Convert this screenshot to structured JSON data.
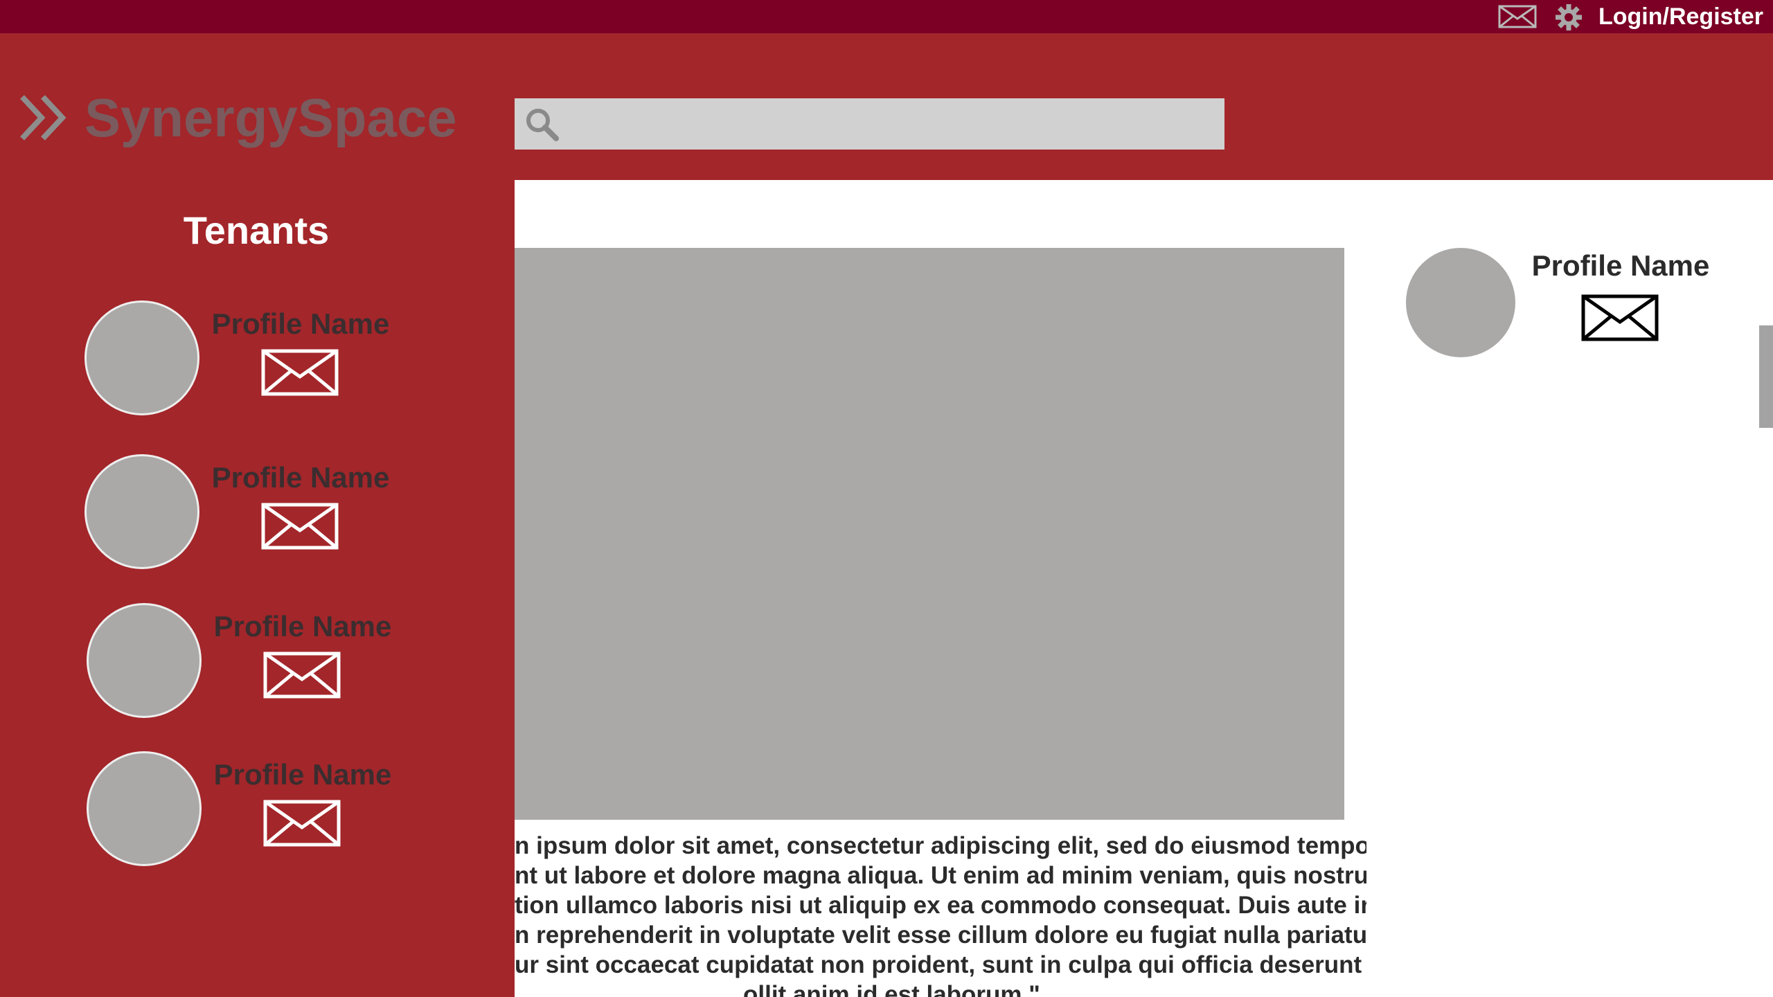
{
  "topbar": {
    "login_label": "Login/Register",
    "icons": [
      "mail-icon",
      "gear-icon"
    ]
  },
  "brand": {
    "name": "SynergySpace",
    "icon": "chevrons-icon"
  },
  "search": {
    "placeholder": "",
    "value": "",
    "icon": "search-icon"
  },
  "sidebar": {
    "title": "Tenants",
    "tenants": [
      {
        "name": "Profile Name"
      },
      {
        "name": "Profile Name"
      },
      {
        "name": "Profile Name"
      },
      {
        "name": "Profile Name"
      }
    ]
  },
  "main": {
    "body_lines": [
      "n ipsum dolor sit amet, consectetur adipiscing elit, sed do eiusmod tempor",
      "nt ut labore et dolore magna aliqua. Ut enim ad minim veniam, quis nostrud",
      "tion ullamco laboris nisi ut aliquip ex ea commodo consequat. Duis aute irure",
      "n reprehenderit in voluptate velit esse cillum dolore eu fugiat nulla pariatur.",
      "ur sint occaecat cupidatat non proident, sunt in culpa qui officia deserunt m",
      "ollit anim id est laborum.\""
    ],
    "side_profile": {
      "name": "Profile Name"
    }
  },
  "colors": {
    "topbar": "#7c0025",
    "header": "#a3262a",
    "placeholder_gray": "#aaa9a8",
    "search_bg": "#d1d1d1",
    "brand_text": "#7a5a5d"
  }
}
